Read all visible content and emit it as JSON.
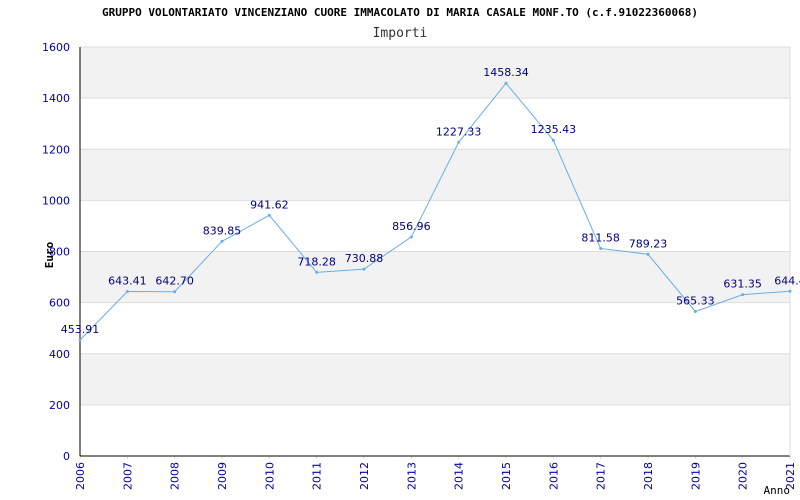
{
  "chart_data": {
    "type": "line",
    "title": "GRUPPO VOLONTARIATO VINCENZIANO CUORE IMMACOLATO DI MARIA CASALE MONF.TO (c.f.91022360068)",
    "subtitle": "Importi",
    "xlabel": "Anno",
    "ylabel": "Euro",
    "ylim": [
      0,
      1600
    ],
    "yticks": [
      "0",
      "200",
      "400",
      "600",
      "800",
      "1000",
      "1200",
      "1400",
      "1600"
    ],
    "ytick_values": [
      0,
      200,
      400,
      600,
      800,
      1000,
      1200,
      1400,
      1600
    ],
    "grid": true,
    "x": [
      "2006",
      "2007",
      "2008",
      "2009",
      "2010",
      "2011",
      "2012",
      "2013",
      "2014",
      "2015",
      "2016",
      "2017",
      "2018",
      "2019",
      "2020",
      "2021"
    ],
    "series": [
      {
        "values": [
          453.91,
          643.41,
          642.7,
          839.85,
          941.62,
          718.28,
          730.88,
          856.96,
          1227.33,
          1458.34,
          1235.43,
          811.58,
          789.23,
          565.33,
          631.35,
          644.4
        ],
        "labels": [
          "453.91",
          "643.41",
          "642.70",
          "839.85",
          "941.62",
          "718.28",
          "730.88",
          "856.96",
          "1227.33",
          "1458.34",
          "1235.43",
          "811.58",
          "789.23",
          "565.33",
          "631.35",
          "644.4"
        ]
      }
    ],
    "colors": {
      "line": "#6aaee6",
      "axis_text": "#0000aa",
      "label_text": "#000080",
      "title_text": "#000000",
      "band": "#f2f2f2",
      "grid": "#dddddd",
      "axis": "#000000"
    }
  }
}
